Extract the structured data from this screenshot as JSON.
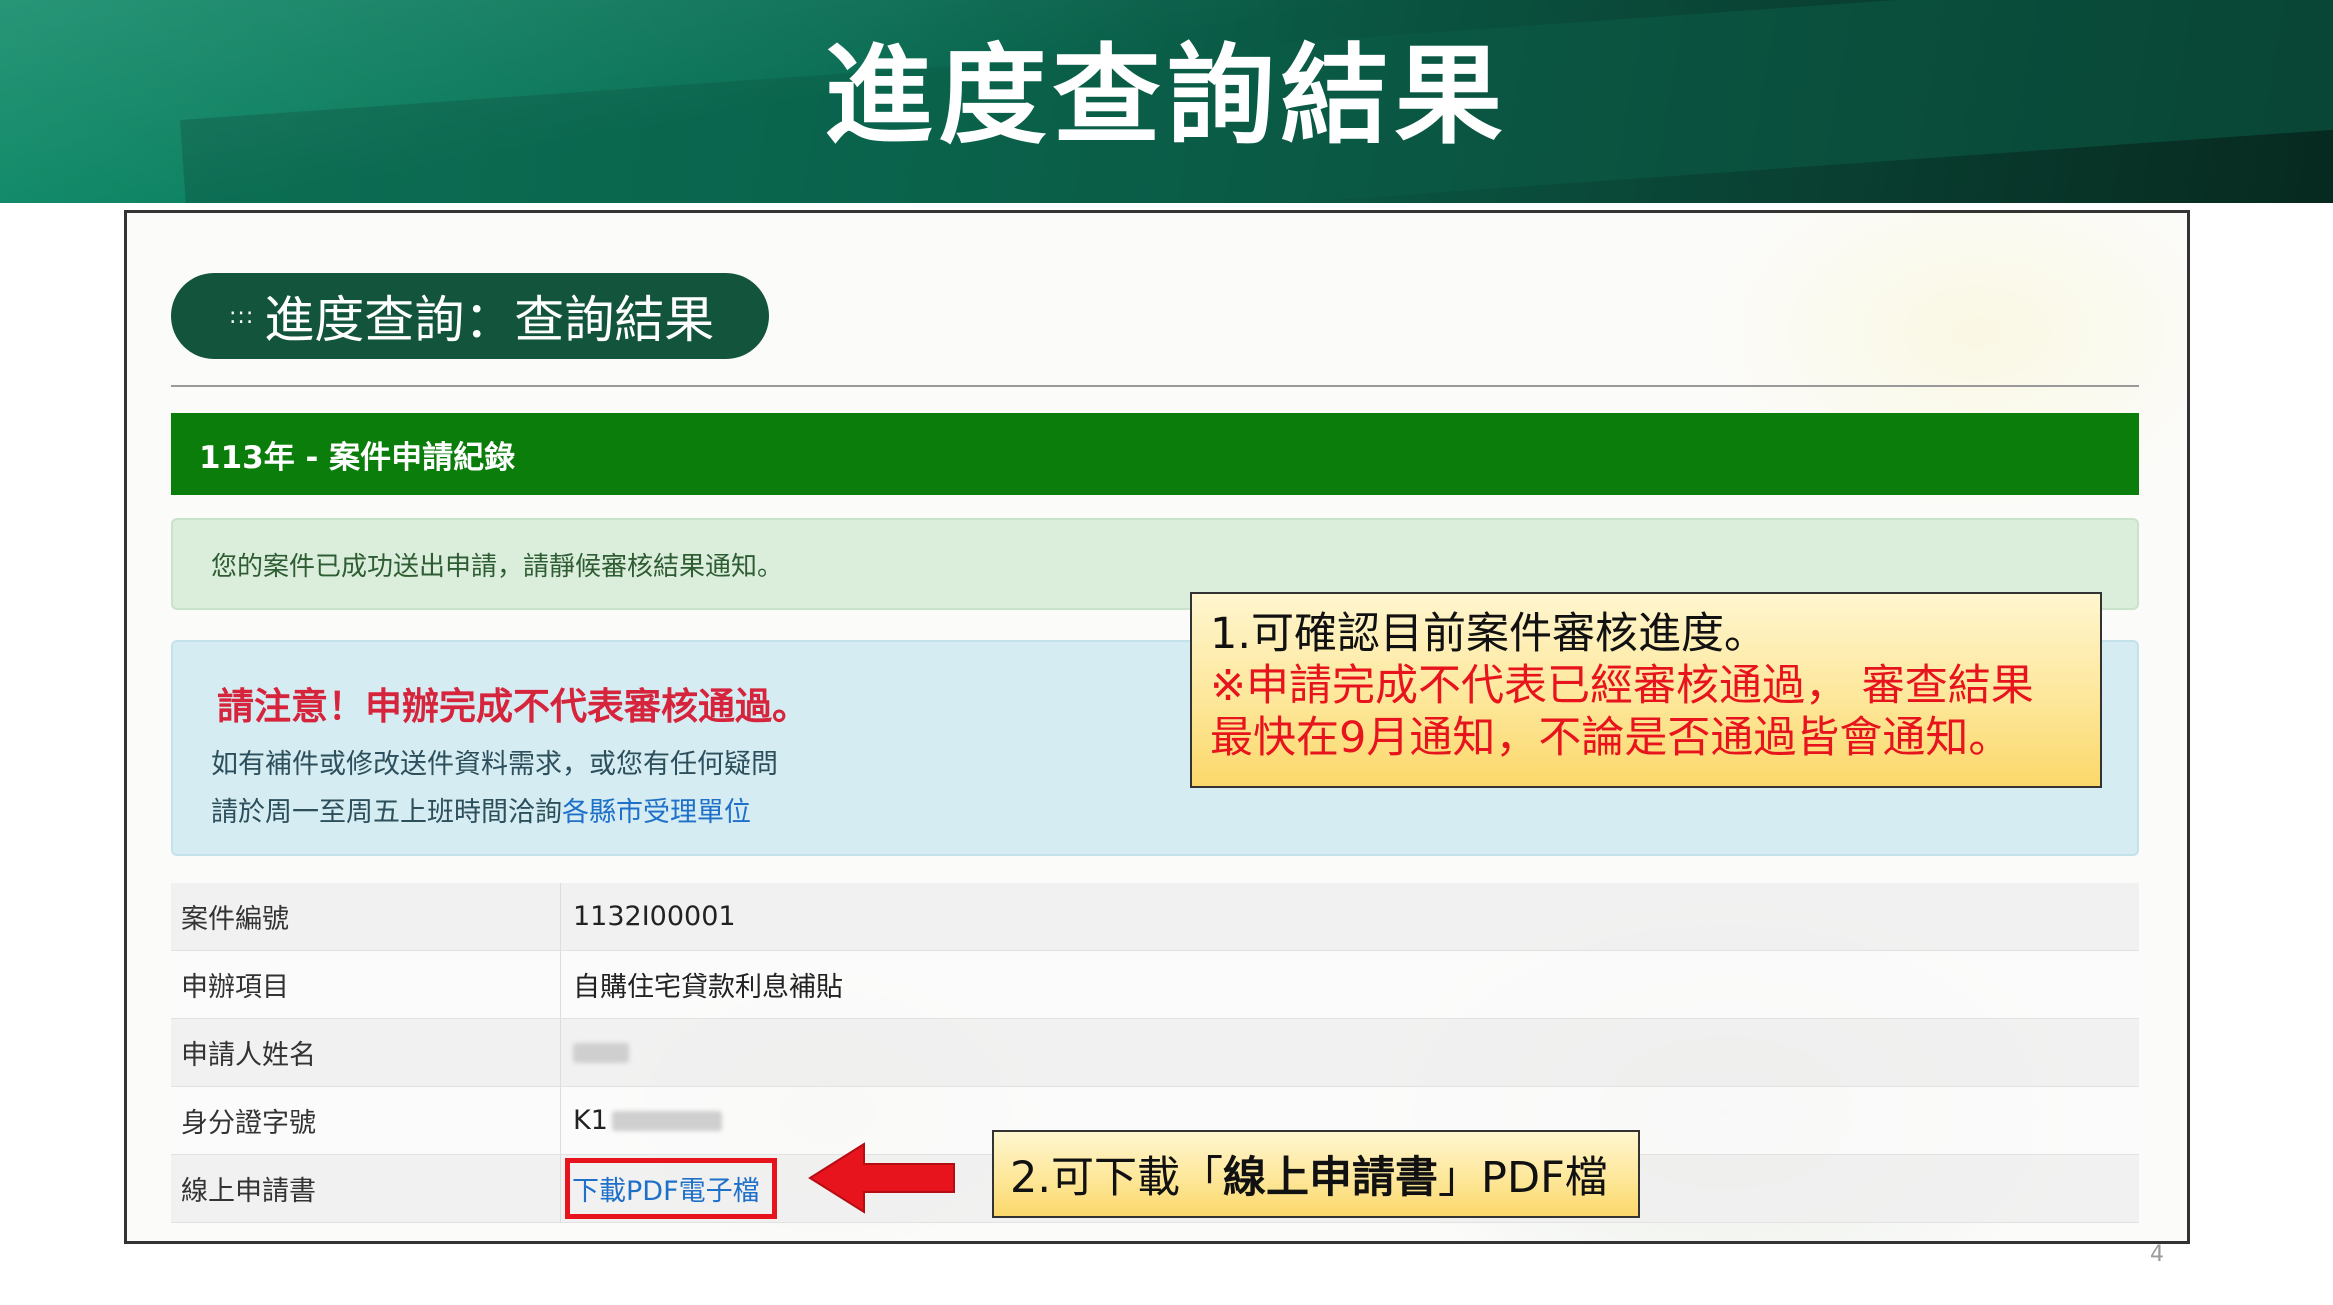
{
  "slide": {
    "title": "進度查詢結果",
    "page_number": "4"
  },
  "page": {
    "pill_dots": ":::",
    "pill_title": "進度查詢：查詢結果",
    "record_header": "113年 - 案件申請紀錄",
    "success_message": "您的案件已成功送出申請，請靜候審核結果通知。",
    "notice": {
      "title": "請注意！申辦完成不代表審核通過。",
      "line1": "如有補件或修改送件資料需求，或您有任何疑問",
      "line2_prefix": "請於周一至周五上班時間洽詢",
      "line2_link": "各縣市受理單位"
    },
    "table": {
      "case_no_label": "案件編號",
      "case_no_value": "1132I00001",
      "item_label": "申辦項目",
      "item_value": "自購住宅貸款利息補貼",
      "applicant_label": "申請人姓名",
      "id_label": "身分證字號",
      "id_value_visible": "K1",
      "form_label": "線上申請書",
      "form_link": "下載PDF電子檔"
    }
  },
  "callouts": {
    "c1_line1": "1.可確認目前案件審核進度。",
    "c1_line2": "※申請完成不代表已經審核通過， 審查結果",
    "c1_line3": "最快在9月通知，不論是否通過皆會通知。",
    "c2_prefix": "2.可下載「",
    "c2_bold": "線上申請書",
    "c2_suffix": "」PDF檔"
  },
  "colors": {
    "header_green": "#0a6f55",
    "record_bar_green": "#0a7d0a",
    "alert_red": "#e8141d",
    "link_blue": "#1f70c9"
  }
}
